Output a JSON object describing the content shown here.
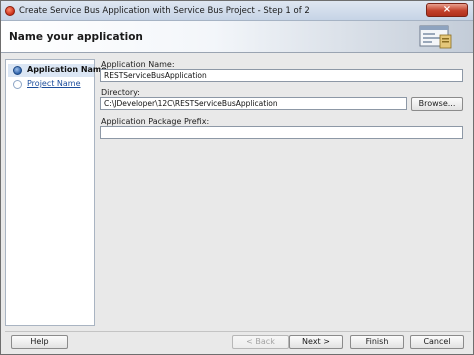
{
  "window": {
    "title": "Create Service Bus Application with Service Bus Project - Step 1 of 2",
    "close_symbol": "×"
  },
  "header": {
    "title": "Name your application",
    "graphic_icon": "wizard-banner-icon"
  },
  "sidebar": {
    "steps": [
      {
        "label": "Application Name",
        "state": "active"
      },
      {
        "label": "Project Name",
        "state": "pending"
      }
    ]
  },
  "form": {
    "app_name": {
      "label": "Application Name:",
      "value": "RESTServiceBusApplication"
    },
    "directory": {
      "label": "Directory:",
      "value": "C:\\JDeveloper\\12C\\RESTServiceBusApplication",
      "browse_label": "Browse..."
    },
    "package_prefix": {
      "label": "Application Package Prefix:",
      "value": ""
    }
  },
  "footer": {
    "help_label": "Help",
    "back_label": "< Back",
    "next_label": "Next >",
    "finish_label": "Finish",
    "cancel_label": "Cancel"
  },
  "colors": {
    "title_bar": "#c6d4e6",
    "close_button": "#c2412b",
    "active_step": "#2d61a9",
    "link": "#1c4d9c"
  }
}
